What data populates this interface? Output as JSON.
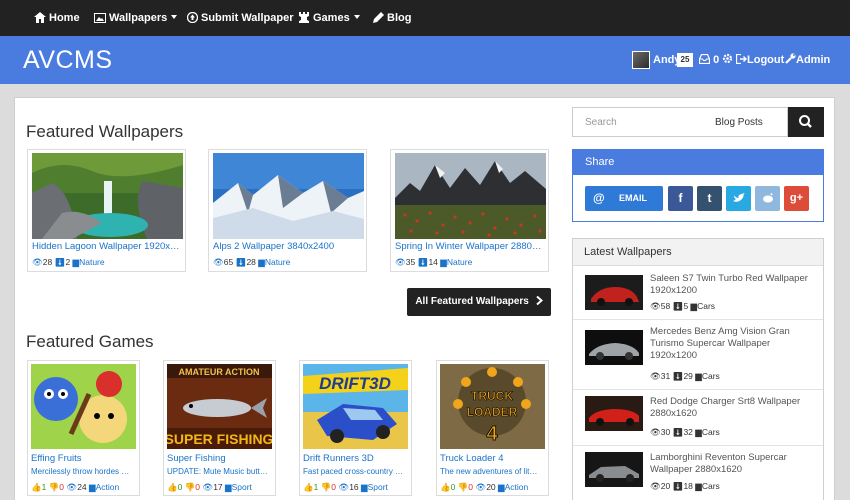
{
  "nav": {
    "home": "Home",
    "wallpapers": "Wallpapers",
    "submit": "Submit Wallpaper",
    "games": "Games",
    "blog": "Blog"
  },
  "header": {
    "brand": "AVCMS",
    "username": "Andy",
    "badge": "25",
    "messages": "0",
    "logout": "Logout",
    "admin": "Admin"
  },
  "featured_wallpapers": {
    "title": "Featured Wallpapers",
    "items": [
      {
        "title": "Hidden Lagoon Wallpaper 1920x…",
        "views": "28",
        "downloads": "2",
        "category": "Nature"
      },
      {
        "title": "Alps 2 Wallpaper 3840x2400",
        "views": "65",
        "downloads": "28",
        "category": "Nature"
      },
      {
        "title": "Spring In Winter Wallpaper 2880…",
        "views": "35",
        "downloads": "14",
        "category": "Nature"
      }
    ],
    "all_button": "All Featured Wallpapers"
  },
  "featured_games": {
    "title": "Featured Games",
    "items": [
      {
        "title": "Effing Fruits",
        "desc": "Mercilessly throw hordes …",
        "likes": "1",
        "dislikes": "0",
        "views": "24",
        "category": "Action"
      },
      {
        "title": "Super Fishing",
        "desc": "UPDATE: Mute Music butt…",
        "likes": "0",
        "dislikes": "0",
        "views": "17",
        "category": "Sport"
      },
      {
        "title": "Drift Runners 3D",
        "desc": "Fast paced cross-country …",
        "likes": "1",
        "dislikes": "0",
        "views": "16",
        "category": "Sport"
      },
      {
        "title": "Truck Loader 4",
        "desc": "The new adventures of lit…",
        "likes": "0",
        "dislikes": "0",
        "views": "20",
        "category": "Action"
      }
    ],
    "thumb_text": {
      "amateur": "AMATEUR ACTION",
      "super_fishing": "SUPER FISHING",
      "drift": "DRIFT3D",
      "truck": "TRUCK",
      "loader": "LOADER",
      "four": "4"
    }
  },
  "search": {
    "placeholder": "Search",
    "scope": "Blog Posts"
  },
  "share": {
    "title": "Share",
    "email": "EMAIL"
  },
  "latest": {
    "title": "Latest Wallpapers",
    "items": [
      {
        "title": "Saleen S7 Twin Turbo Red Wallpaper 1920x1200",
        "views": "58",
        "downloads": "5",
        "category": "Cars"
      },
      {
        "title": "Mercedes Benz Amg Vision Gran Turismo Supercar Wallpaper 1920x1200",
        "views": "31",
        "downloads": "29",
        "category": "Cars"
      },
      {
        "title": "Red Dodge Charger Srt8 Wallpaper 2880x1620",
        "views": "30",
        "downloads": "32",
        "category": "Cars"
      },
      {
        "title": "Lamborghini Reventon Supercar Wallpaper 2880x1620",
        "views": "20",
        "downloads": "18",
        "category": "Cars"
      }
    ]
  },
  "colors": {
    "nav_bg": "#222222",
    "header_bg": "#4a7ce0",
    "link": "#1a73c9",
    "facebook": "#3b5998",
    "tumblr": "#34526f",
    "twitter": "#29a9e1",
    "reddit": "#8fb8de",
    "google": "#dd4b39"
  }
}
